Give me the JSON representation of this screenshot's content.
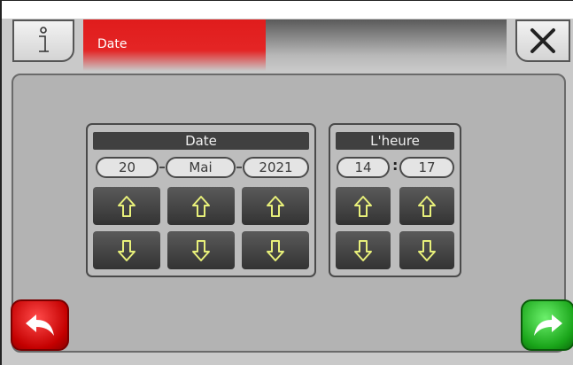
{
  "header": {
    "title": "Date",
    "info_icon": "info-icon",
    "close_icon": "close-icon"
  },
  "date_group": {
    "label": "Date",
    "day": "20",
    "month": "Mai",
    "year": "2021"
  },
  "time_group": {
    "label": "L'heure",
    "hour": "14",
    "minute": "17"
  },
  "icons": {
    "increment": "arrow-up-icon",
    "decrement": "arrow-down-icon",
    "back": "back-arrow-icon",
    "next": "next-arrow-icon"
  },
  "colors": {
    "header_accent": "#e42525",
    "arrow_glyph": "#e8f07a",
    "back_button": "#d40000",
    "next_button": "#1aa51a"
  }
}
